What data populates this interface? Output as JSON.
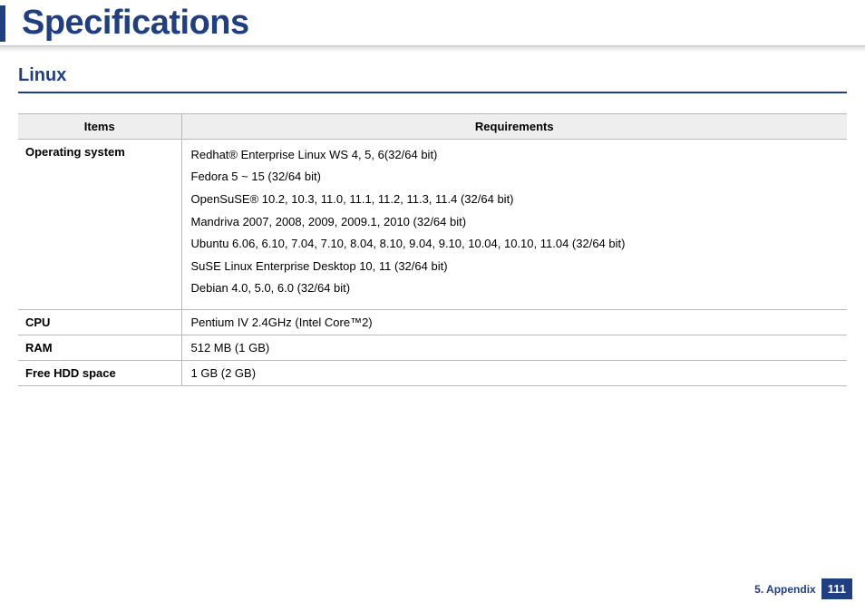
{
  "page_title": "Specifications",
  "section_heading": "Linux",
  "table": {
    "headers": {
      "items": "Items",
      "requirements": "Requirements"
    },
    "rows": [
      {
        "item": "Operating system",
        "requirements": [
          "Redhat® Enterprise Linux WS 4, 5, 6(32/64 bit)",
          "Fedora 5 ~ 15 (32/64 bit)",
          "OpenSuSE® 10.2, 10.3, 11.0, 11.1, 11.2, 11.3, 11.4 (32/64 bit)",
          "Mandriva 2007, 2008, 2009, 2009.1, 2010 (32/64 bit)",
          "Ubuntu 6.06, 6.10, 7.04, 7.10, 8.04, 8.10, 9.04, 9.10, 10.04, 10.10, 11.04 (32/64 bit)",
          "SuSE Linux Enterprise Desktop 10, 11 (32/64 bit)",
          "Debian 4.0, 5.0, 6.0 (32/64 bit)"
        ]
      },
      {
        "item": "CPU",
        "requirements": [
          "Pentium IV 2.4GHz (Intel Core™2)"
        ]
      },
      {
        "item": "RAM",
        "requirements": [
          "512 MB (1 GB)"
        ]
      },
      {
        "item": "Free HDD space",
        "requirements": [
          "1 GB (2 GB)"
        ]
      }
    ]
  },
  "footer": {
    "chapter": "5. Appendix",
    "page": "111"
  }
}
